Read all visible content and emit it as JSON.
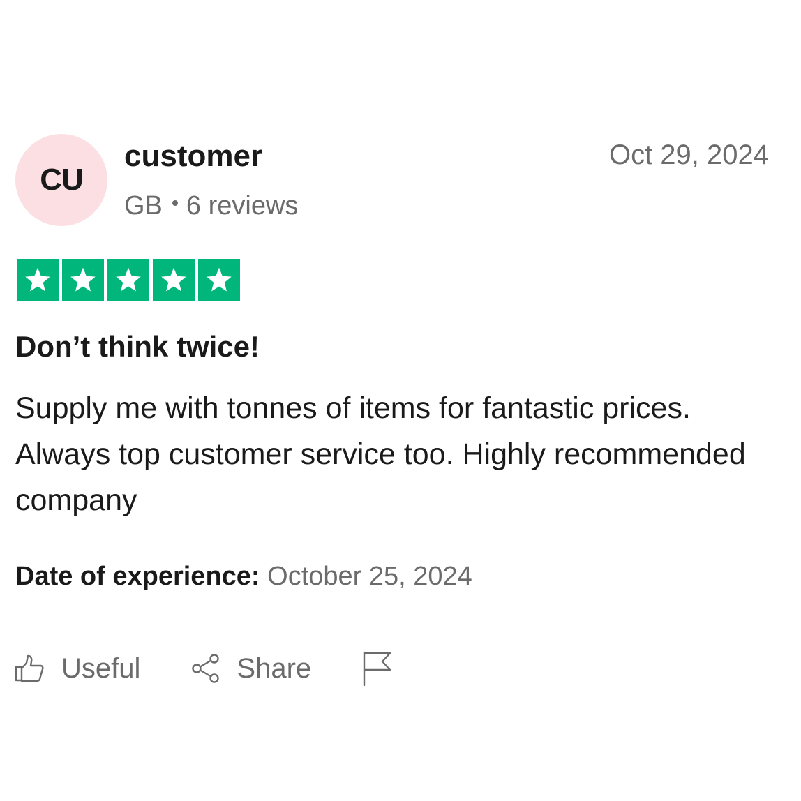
{
  "review": {
    "avatar_initials": "CU",
    "avatar_color": "#fbdfe3",
    "author_name": "customer",
    "country": "GB",
    "review_count": "6 reviews",
    "posted_date": "Oct 29, 2024",
    "rating": 5,
    "rating_max": 5,
    "star_color": "#00b67a",
    "title": "Don’t think twice!",
    "text": "Supply me with tonnes of items for fantastic prices. Always top customer service too. Highly recommended company",
    "experience_label": "Date of experience:",
    "experience_date": "October 25, 2024"
  },
  "actions": {
    "useful_label": "Useful",
    "useful_icon": "thumbs-up-icon",
    "share_label": "Share",
    "share_icon": "share-icon",
    "report_icon": "flag-icon"
  }
}
